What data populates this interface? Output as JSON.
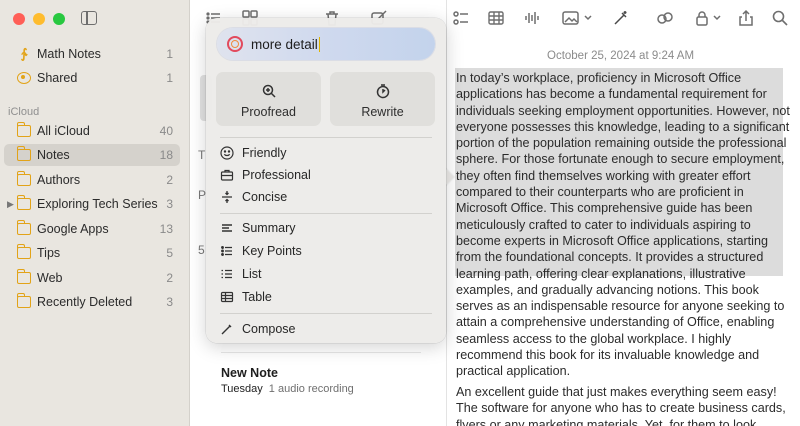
{
  "sidebar": {
    "section_icloud": "iCloud",
    "items": [
      {
        "label": "Math Notes",
        "count": "1",
        "icon": "math-notes-icon"
      },
      {
        "label": "Shared",
        "count": "1",
        "icon": "shared-icon"
      },
      {
        "label": "All iCloud",
        "count": "40",
        "icon": "folder-icon"
      },
      {
        "label": "Notes",
        "count": "18",
        "icon": "folder-icon"
      },
      {
        "label": "Authors",
        "count": "2",
        "icon": "folder-icon"
      },
      {
        "label": "Exploring Tech Series",
        "count": "3",
        "icon": "folder-icon"
      },
      {
        "label": "Google Apps",
        "count": "13",
        "icon": "folder-icon"
      },
      {
        "label": "Tips",
        "count": "5",
        "icon": "folder-icon"
      },
      {
        "label": "Web",
        "count": "2",
        "icon": "folder-icon"
      },
      {
        "label": "Recently Deleted",
        "count": "3",
        "icon": "folder-icon"
      }
    ]
  },
  "list": {
    "hint_1": "T",
    "hint_2": "P",
    "hint_3": "5",
    "note": {
      "title": "New Note",
      "day": "Tuesday",
      "meta": "1 audio recording"
    }
  },
  "editor": {
    "date": "October 25, 2024 at 9:24 AM",
    "paragraph_1": "In today’s workplace, proficiency in Microsoft Office applications has become a fundamental requirement for individuals seeking employment opportunities. However, not everyone possesses this knowledge, leading to a significant portion of the population remaining outside the professional sphere. For those fortunate enough to secure employment, they often find themselves working with greater effort compared to their counterparts who are proficient in Microsoft Office. This comprehensive guide has been meticulously crafted to cater to individuals aspiring to become experts in Microsoft Office applications, starting from the foundational concepts. It provides a structured learning path, offering clear explanations, illustrative examples, and gradually advancing notions. This book serves as an indispensable resource for anyone seeking to attain a comprehensive understanding of Office, enabling seamless access to the global workplace. I highly recommend this book for its invaluable knowledge and practical application.",
    "paragraph_2": "An excellent guide that  just makes everything seem easy! The software for anyone who has to create business cards, flyers or any marketing materials. Yet, for them to look"
  },
  "writing_tools": {
    "input_value": "more detail",
    "proofread_label": "Proofread",
    "rewrite_label": "Rewrite",
    "tone_items": [
      "Friendly",
      "Professional",
      "Concise"
    ],
    "format_items": [
      "Summary",
      "Key Points",
      "List",
      "Table"
    ],
    "compose_label": "Compose"
  },
  "colors": {
    "sidebar_bg": "#e9e6e0",
    "folder_accent": "#e2a318",
    "selection_highlight": "#dcdcdc",
    "popover_bg": "#ecebe9"
  }
}
